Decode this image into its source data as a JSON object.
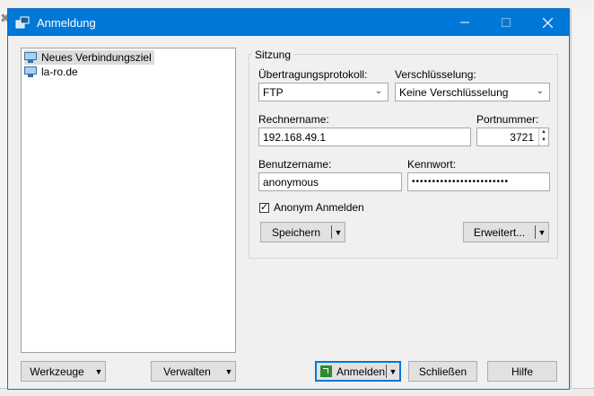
{
  "window": {
    "title": "Anmeldung",
    "minimize_icon": "minimize-icon",
    "maximize_icon": "maximize-icon",
    "close_icon": "close-icon"
  },
  "tree": {
    "items": [
      {
        "label": "Neues Verbindungsziel",
        "icon": "monitor-icon",
        "selected": true
      },
      {
        "label": "la-ro.de",
        "icon": "monitor-icon",
        "selected": false
      }
    ]
  },
  "session": {
    "legend": "Sitzung",
    "protocol_label": "Übertragungsprotokoll:",
    "protocol_value": "FTP",
    "encryption_label": "Verschlüsselung:",
    "encryption_value": "Keine Verschlüsselung",
    "host_label": "Rechnername:",
    "host_value": "192.168.49.1",
    "port_label": "Portnummer:",
    "port_value": "3721",
    "user_label": "Benutzername:",
    "user_value": "anonymous",
    "password_label": "Kennwort:",
    "password_value": "••••••••••••••••••••••••",
    "anonymous_label": "Anonym Anmelden",
    "anonymous_checked": true,
    "save_button": "Speichern",
    "advanced_button": "Erweitert..."
  },
  "footer": {
    "tools_button": "Werkzeuge",
    "manage_button": "Verwalten",
    "login_button": "Anmelden",
    "close_button": "Schließen",
    "help_button": "Hilfe"
  },
  "colors": {
    "accent": "#0078d7",
    "window_bg": "#f0f0f0"
  }
}
